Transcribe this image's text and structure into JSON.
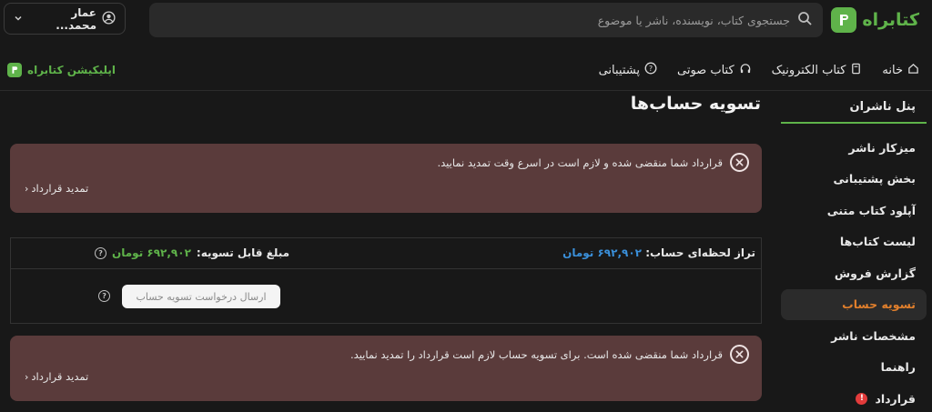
{
  "brand": {
    "name": "کتابراه"
  },
  "search": {
    "placeholder": "جستجوی کتاب، نویسنده، ناشر یا موضوع"
  },
  "user": {
    "name": "عمار محمد..."
  },
  "nav": {
    "items": [
      {
        "label": "خانه",
        "icon": "home-icon"
      },
      {
        "label": "کتاب الکترونیک",
        "icon": "ebook-icon"
      },
      {
        "label": "کتاب صوتی",
        "icon": "headphones-icon"
      },
      {
        "label": "پشتیبانی",
        "icon": "help-icon"
      }
    ],
    "app_link": "اپلیکیشن کتابراه"
  },
  "sidebar": {
    "title": "پنل ناشران",
    "items": [
      {
        "label": "میزکار ناشر"
      },
      {
        "label": "بخش پشتیبانی"
      },
      {
        "label": "آپلود کتاب متنی"
      },
      {
        "label": "لیست کتاب‌ها"
      },
      {
        "label": "گزارش فروش"
      },
      {
        "label": "تسویه حساب"
      },
      {
        "label": "مشخصات ناشر"
      },
      {
        "label": "راهنما"
      },
      {
        "label": "قرارداد",
        "badge": "!"
      }
    ],
    "active_index": 5
  },
  "main": {
    "title": "تسویه حساب‌ها",
    "alert1": {
      "message": "قرارداد شما منقضی شده و لازم است در اسرع وقت تمدید نمایید.",
      "link": "تمدید قرارداد"
    },
    "balance": {
      "label": "تراز لحظه‌ای حساب:",
      "value": "۶۹۲,۹۰۲ تومان",
      "settle_label": "مبلغ قابل تسویه:",
      "settle_value": "۶۹۲,۹۰۲ تومان",
      "button": "ارسال درخواست تسویه حساب"
    },
    "alert2": {
      "message": "قرارداد شما منقضی شده است. برای تسویه حساب لازم است قرارداد را تمدید نمایید.",
      "link": "تمدید قرارداد"
    }
  },
  "colors": {
    "accent": "#5fb34a",
    "active": "#e07f2c",
    "alert_bg": "#5a3b3b",
    "money_blue": "#3a8fd9"
  }
}
